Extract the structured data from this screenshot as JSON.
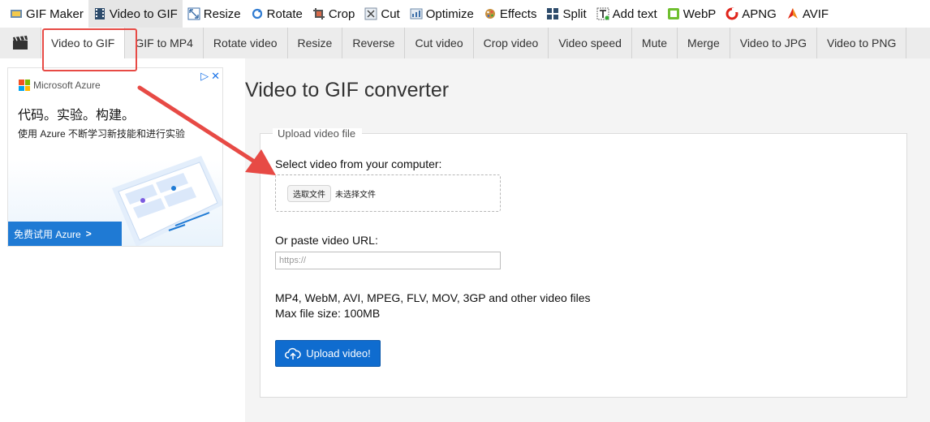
{
  "topnav": {
    "items": [
      {
        "label": "GIF Maker",
        "icon": "gif-maker-icon"
      },
      {
        "label": "Video to GIF",
        "icon": "film-icon"
      },
      {
        "label": "Resize",
        "icon": "resize-icon"
      },
      {
        "label": "Rotate",
        "icon": "rotate-icon"
      },
      {
        "label": "Crop",
        "icon": "crop-icon"
      },
      {
        "label": "Cut",
        "icon": "scissors-icon"
      },
      {
        "label": "Optimize",
        "icon": "optimize-icon"
      },
      {
        "label": "Effects",
        "icon": "effects-icon"
      },
      {
        "label": "Split",
        "icon": "split-icon"
      },
      {
        "label": "Add text",
        "icon": "add-text-icon"
      },
      {
        "label": "WebP",
        "icon": "webp-icon"
      },
      {
        "label": "APNG",
        "icon": "apng-icon"
      },
      {
        "label": "AVIF",
        "icon": "avif-icon"
      }
    ],
    "active_index": 1
  },
  "subnav": {
    "tabs": [
      "Video to GIF",
      "GIF to MP4",
      "Rotate video",
      "Resize",
      "Reverse",
      "Cut video",
      "Crop video",
      "Video speed",
      "Mute",
      "Merge",
      "Video to JPG",
      "Video to PNG"
    ],
    "active_index": 0
  },
  "ad": {
    "brand": "Microsoft Azure",
    "headline": "代码。实验。构建。",
    "description": "使用 Azure 不断学习新技能和进行实验",
    "cta": "免费试用 Azure",
    "cta_chevron": ">",
    "adchoices": "▷",
    "close": "✕"
  },
  "main": {
    "title": "Video to GIF converter",
    "panel_legend": "Upload video file",
    "select_label": "Select video from your computer:",
    "file_button": "选取文件",
    "file_status": "未选择文件",
    "url_label": "Or paste video URL:",
    "url_placeholder": "https://",
    "formats_text": "MP4, WebM, AVI, MPEG, FLV, MOV, 3GP and other video files",
    "max_size_text": "Max file size: 100MB",
    "upload_button": "Upload video!"
  },
  "colors": {
    "accent_blue": "#0f6ccf",
    "annotation_red": "#e74a45",
    "subnav_bg": "#ececec",
    "main_bg": "#f4f4f4"
  }
}
